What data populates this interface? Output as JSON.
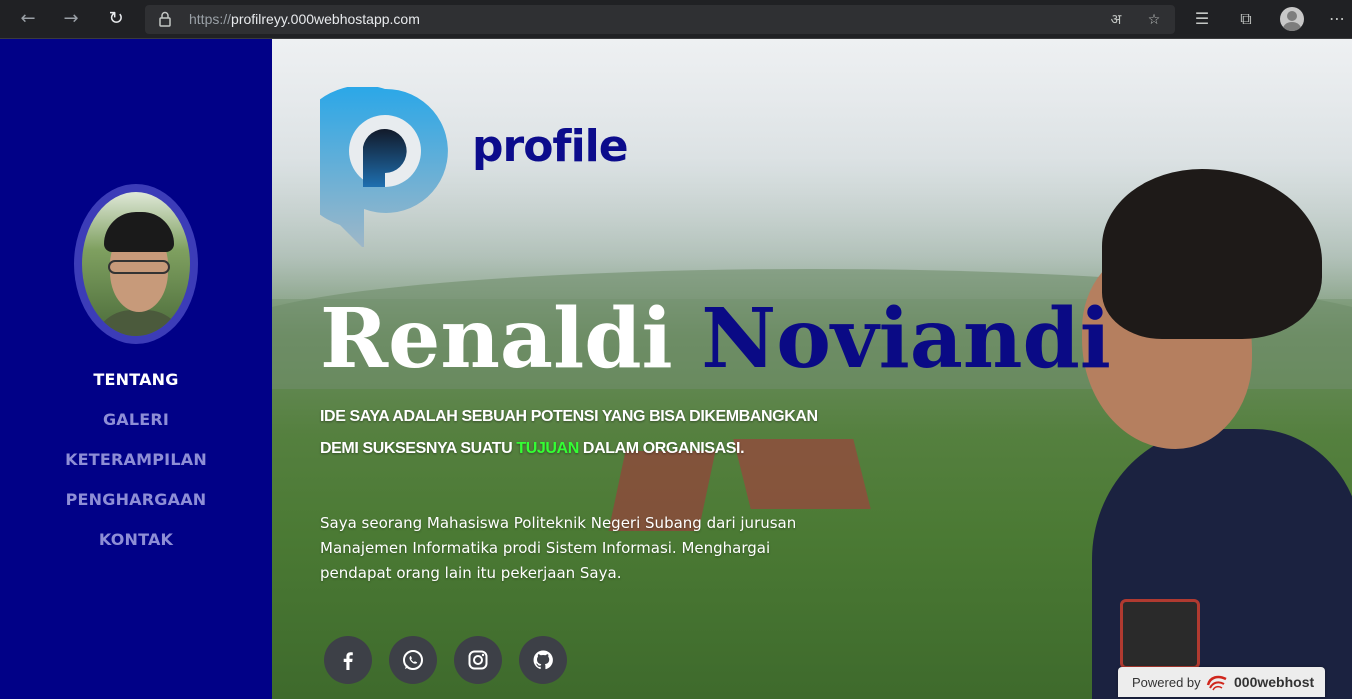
{
  "browser": {
    "url_protocol": "https://",
    "url_host": "profilreyy.000webhostapp.com"
  },
  "sidebar": {
    "nav": [
      {
        "label": "TENTANG",
        "active": true
      },
      {
        "label": "GALERI",
        "active": false
      },
      {
        "label": "KETERAMPILAN",
        "active": false
      },
      {
        "label": "PENGHARGAAN",
        "active": false
      },
      {
        "label": "KONTAK",
        "active": false
      }
    ]
  },
  "hero": {
    "logo_text": "profile",
    "first_name": "Renaldi",
    "last_name": "Noviandi",
    "tagline_part1": "IDE SAYA ADALAH SEBUAH POTENSI YANG BISA DIKEMBANGKAN DEMI SUKSESNYA SUATU ",
    "tagline_highlight": "TUJUAN",
    "tagline_part2": " DALAM ORGANISASI.",
    "bio": "Saya seorang Mahasiswa Politeknik Negeri Subang dari jurusan Manajemen Informatika prodi Sistem Informasi. Menghargai pendapat orang lain itu pekerjaan Saya.",
    "socials": [
      "facebook-icon",
      "whatsapp-icon",
      "instagram-icon",
      "github-icon"
    ]
  },
  "footer_badge": {
    "label": "Powered by",
    "brand": "000webhost"
  },
  "colors": {
    "sidebar": "#010187",
    "name_accent": "#0a0a85",
    "highlight": "#33ff33"
  }
}
